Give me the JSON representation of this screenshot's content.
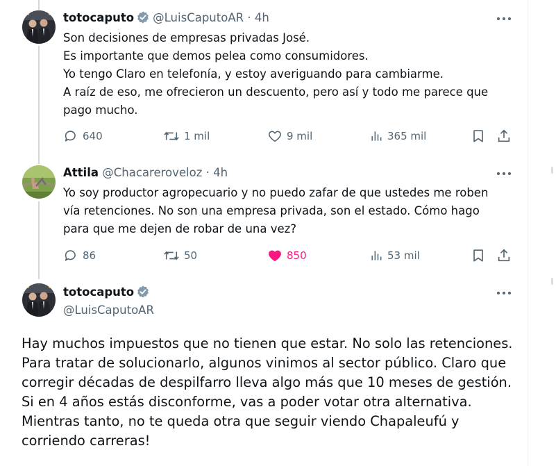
{
  "thread": [
    {
      "author": {
        "name": "totocaputo",
        "handle": "@LuisCaputoAR",
        "verified": true
      },
      "sep": "·",
      "time": "4h",
      "lines": [
        "Son decisiones de empresas privadas José.",
        "Es importante que demos pelea como consumidores.",
        "Yo tengo Claro en telefonía, y estoy averiguando para cambiarme.",
        "A raíz de eso, me ofrecieron un descuento, pero así y todo me parece que",
        "pago mucho."
      ],
      "stats": {
        "replies": "640",
        "reposts": "1 mil",
        "likes": "9 mil",
        "views": "365 mil"
      },
      "liked": false
    },
    {
      "author": {
        "name": "Attila",
        "handle": "@Chacareroveloz",
        "verified": false
      },
      "sep": "·",
      "time": "4h",
      "lines": [
        "Yo soy productor agropecuario y no puedo zafar de que ustedes me roben",
        "vía retenciones. No son una empresa privada, son el estado. Cómo hago",
        "para que me dejen de robar de una vez?"
      ],
      "stats": {
        "replies": "86",
        "reposts": "50",
        "likes": "850",
        "views": "53 mil"
      },
      "liked": true
    }
  ],
  "main": {
    "author": {
      "name": "totocaputo",
      "handle": "@LuisCaputoAR",
      "verified": true
    },
    "lines": [
      "Hay muchos impuestos que no tienen que estar. No solo las retenciones.",
      "Para tratar de solucionarlo, algunos vinimos al sector público.  Claro que",
      "corregir décadas de despilfarro lleva algo más que 10 meses de gestión.",
      "Si en 4 años estás disconforme, vas a poder votar otra alternativa.",
      "Mientras tanto, no te queda otra que seguir viendo Chapaleufú y",
      "corriendo carreras!"
    ]
  },
  "icons": {
    "more": "more-dots-icon",
    "reply": "reply-bubble-icon",
    "repost": "repost-arrows-icon",
    "like": "heart-icon",
    "views": "views-bars-icon",
    "bookmark": "bookmark-icon",
    "share": "share-upload-icon",
    "verified": "verified-badge-icon"
  },
  "colors": {
    "text": "#0f1419",
    "secondary": "#536471",
    "like_active": "#f91880",
    "verified_badge": "#829aab",
    "thread_line": "#cfd9de"
  }
}
